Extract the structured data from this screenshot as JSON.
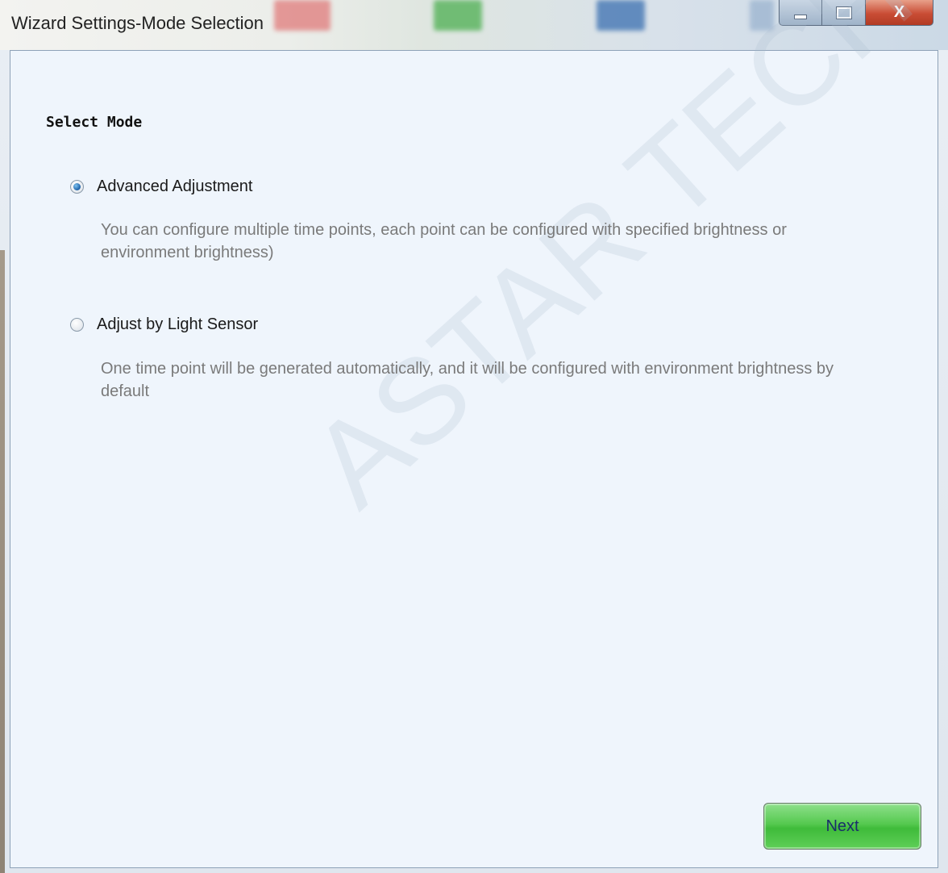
{
  "window": {
    "title": "Wizard Settings-Mode Selection",
    "controls": {
      "minimize": "minimize",
      "maximize": "maximize",
      "close": "X"
    }
  },
  "content": {
    "heading": "Select Mode",
    "options": [
      {
        "label": "Advanced Adjustment",
        "description": "You can configure multiple time points, each point can be configured with specified brightness or environment brightness)",
        "selected": true
      },
      {
        "label": "Adjust by Light Sensor",
        "description": "One time point will be generated automatically, and it will be configured with environment brightness by default",
        "selected": false
      }
    ],
    "watermark": "ASTAR TECH CO., L"
  },
  "footer": {
    "next_label": "Next"
  },
  "colors": {
    "client_bg": "#eff5fc",
    "next_button": "#55c94f",
    "close_button": "#c94d35"
  }
}
